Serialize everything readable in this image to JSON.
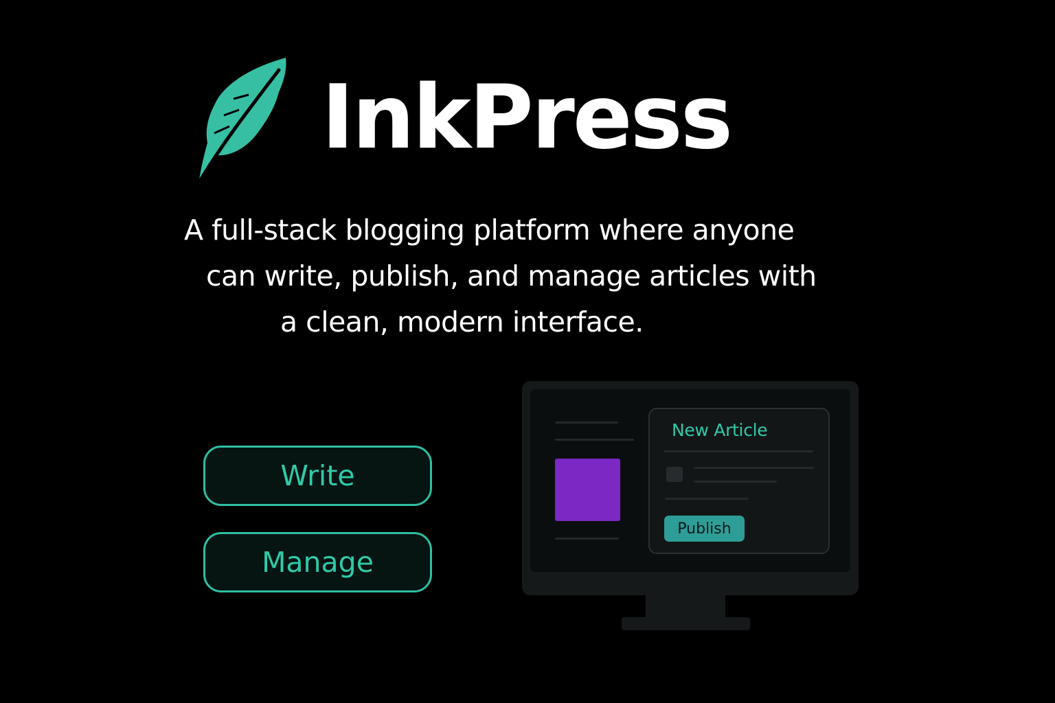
{
  "brand": {
    "name": "InkPress",
    "logo_icon": "feather-icon",
    "accent_color": "#2fbfa3"
  },
  "tagline": {
    "line1": "A full-stack blogging platform where anyone",
    "line2": "can write, publish, and manage articles with",
    "line3": "a clean, modern interface."
  },
  "actions": {
    "write_label": "Write",
    "manage_label": "Manage"
  },
  "illustration": {
    "card_title": "New Article",
    "publish_label": "Publish",
    "thumbnail_color": "#7b28c4"
  }
}
